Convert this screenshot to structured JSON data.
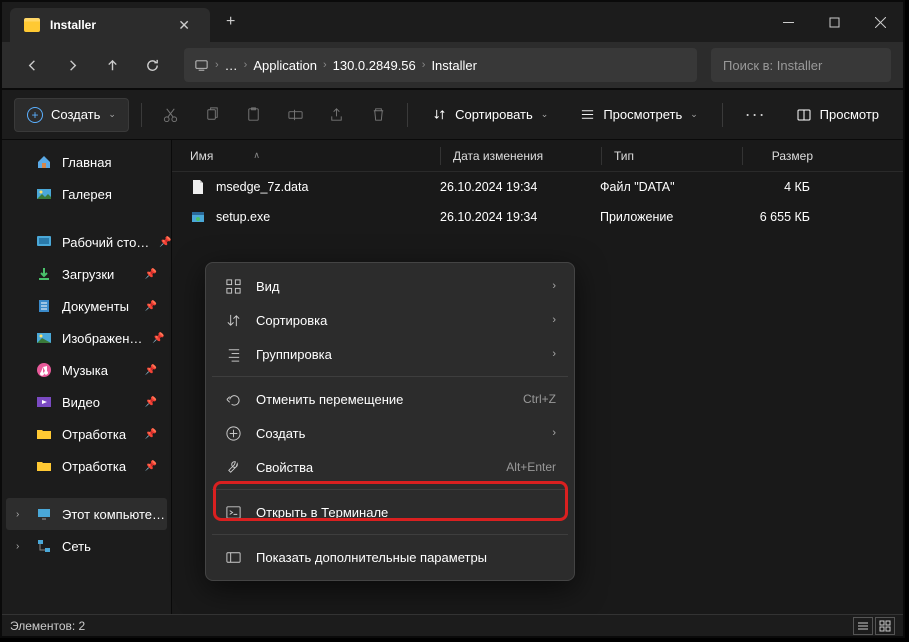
{
  "tab": {
    "title": "Installer"
  },
  "breadcrumb": {
    "ellipsis": "…",
    "items": [
      "Application",
      "130.0.2849.56",
      "Installer"
    ]
  },
  "search": {
    "placeholder": "Поиск в: Installer"
  },
  "toolbar": {
    "create": "Создать",
    "sort": "Сортировать",
    "view": "Просмотреть",
    "preview": "Просмотр"
  },
  "sidebar": {
    "home": "Главная",
    "gallery": "Галерея",
    "desktop": "Рабочий сто…",
    "downloads": "Загрузки",
    "documents": "Документы",
    "pictures": "Изображен…",
    "music": "Музыка",
    "videos": "Видео",
    "custom1": "Отработка",
    "custom2": "Отработка",
    "thispc": "Этот компьюте…",
    "network": "Сеть"
  },
  "columns": {
    "name": "Имя",
    "date": "Дата изменения",
    "type": "Тип",
    "size": "Размер"
  },
  "files": [
    {
      "name": "msedge_7z.data",
      "date": "26.10.2024 19:34",
      "type": "Файл \"DATA\"",
      "size": "4 КБ",
      "icon": "file"
    },
    {
      "name": "setup.exe",
      "date": "26.10.2024 19:34",
      "type": "Приложение",
      "size": "6 655 КБ",
      "icon": "exe"
    }
  ],
  "context": {
    "view": "Вид",
    "sort": "Сортировка",
    "group": "Группировка",
    "undo": "Отменить перемещение",
    "undo_key": "Ctrl+Z",
    "new": "Создать",
    "props": "Свойства",
    "props_key": "Alt+Enter",
    "terminal": "Открыть в Терминале",
    "more": "Показать дополнительные параметры"
  },
  "status": {
    "items": "Элементов: 2"
  }
}
